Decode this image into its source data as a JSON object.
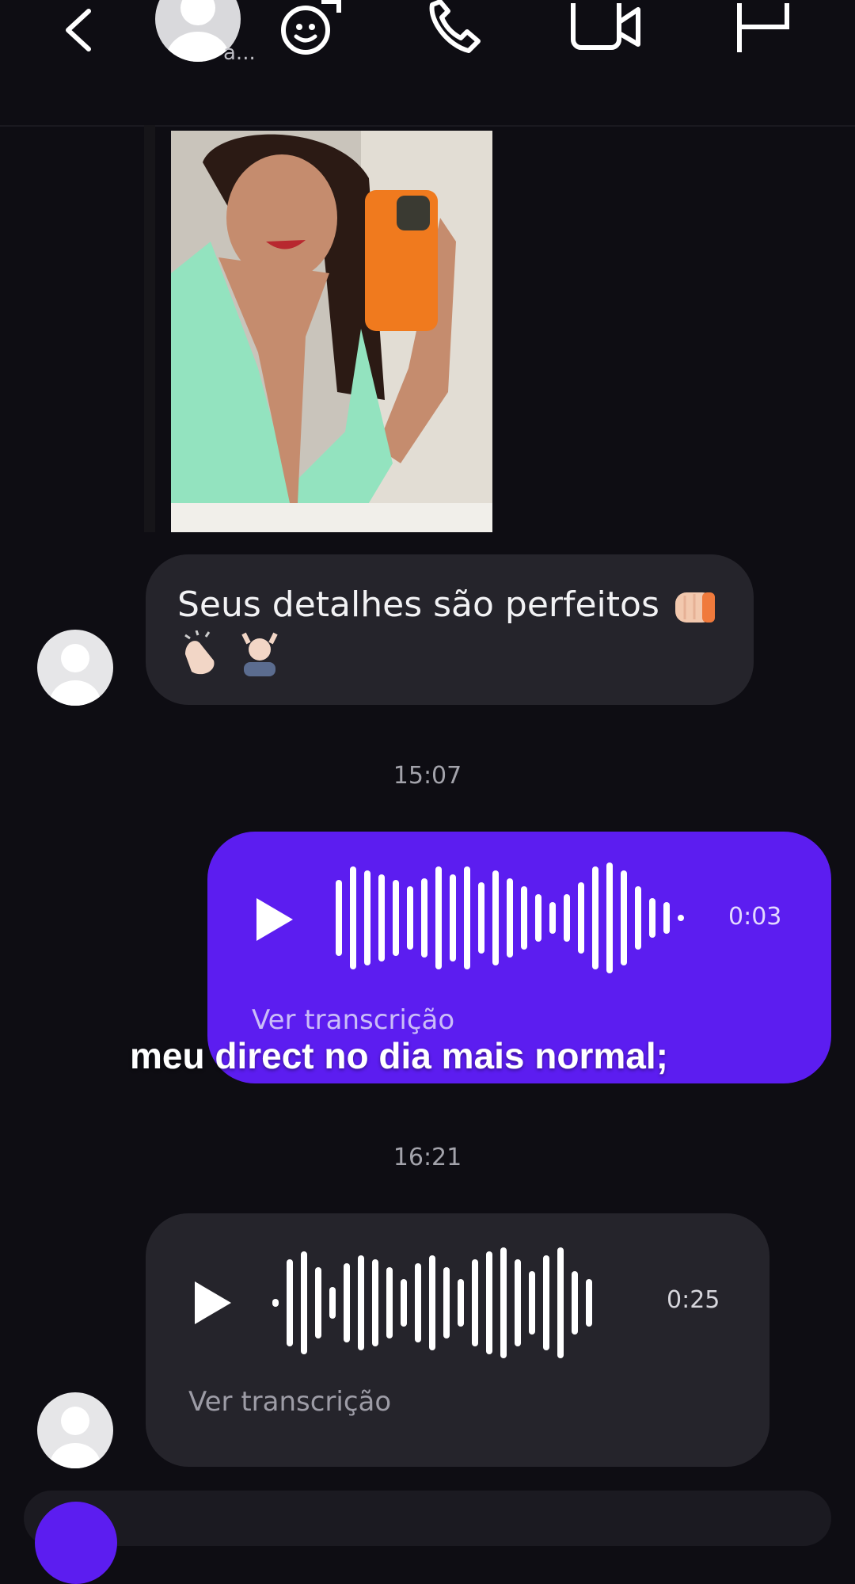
{
  "header": {
    "contact_name_fragment": "a...",
    "icons": [
      "back-icon",
      "sticker-add-icon",
      "phone-icon",
      "video-icon",
      "flag-icon"
    ]
  },
  "messages": {
    "received_text": "Seus detalhes são perfeitos",
    "received_emojis": [
      "fist-bump-icon",
      "clapping-icon",
      "man-getting-massage-icon"
    ],
    "time_1": "15:07",
    "sent_voice_duration": "0:03",
    "sent_voice_transcription": "Ver transcrição",
    "time_2": "16:21",
    "received_voice_duration": "0:25",
    "received_voice_transcription": "Ver transcrição"
  },
  "overlay": {
    "caption": "meu direct no dia mais normal;"
  },
  "colors": {
    "background": "#0e0d13",
    "received_bubble": "#25242b",
    "sent_bubble": "#5c1df0",
    "accent": "#5c1df0"
  }
}
